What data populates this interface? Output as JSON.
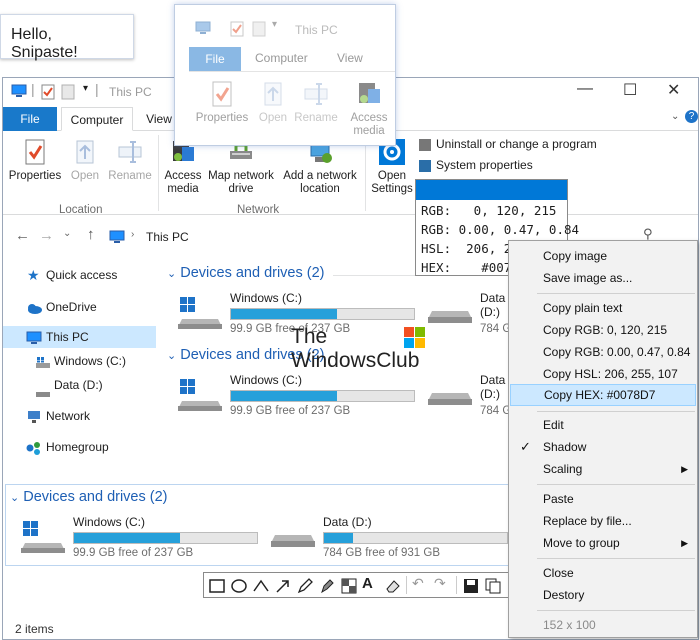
{
  "hello_text": "Hello, Snipaste!",
  "window": {
    "title": "This PC",
    "tabs": [
      "File",
      "Computer",
      "View"
    ],
    "ribbon": {
      "location_buttons": [
        "Properties",
        "Open",
        "Rename"
      ],
      "location_label": "Location",
      "network_buttons": [
        "Access media",
        "Map network drive",
        "Add a network location"
      ],
      "network_label": "Network",
      "system_button": "Open Settings",
      "system_items": [
        "Uninstall or change a program",
        "System properties"
      ]
    },
    "address": "This PC"
  },
  "nav": {
    "items": [
      "Quick access",
      "OneDrive",
      "This PC",
      "Windows (C:)",
      "Data (D:)",
      "Network",
      "Homegroup"
    ]
  },
  "sections": [
    {
      "title": "Devices and drives (2)"
    },
    {
      "title": "Devices and drives (2)"
    },
    {
      "title": "Devices and drives (2)"
    }
  ],
  "drives": {
    "c_name": "Windows (C:)",
    "c_free": "99.9 GB free of 237 GB",
    "c_used": 0.58,
    "d_name": "Data (D:)",
    "d_free": "784 GB free of 931 GB",
    "d_used": 0.16,
    "d_free_short": "784 G"
  },
  "snip": {
    "title": "This PC",
    "tabs": [
      "File",
      "Computer",
      "View"
    ],
    "buttons": [
      "Properties",
      "Open",
      "Rename",
      "Access media"
    ]
  },
  "color_panel": {
    "swatch_color": "#0078D7",
    "rgb": "RGB:   0, 120, 215",
    "rgbf": "RGB: 0.00, 0.47, 0.84",
    "hsl": "HSL:  206, 2",
    "hex": "HEX:    #007"
  },
  "menu": {
    "copy_image": "Copy image",
    "save_image": "Save image as...",
    "copy_plain": "Copy plain text",
    "copy_rgb": "Copy RGB: 0, 120, 215",
    "copy_rgbf": "Copy RGB: 0.00, 0.47, 0.84",
    "copy_hsl": "Copy HSL: 206, 255, 107",
    "copy_hex": "Copy HEX: #0078D7",
    "edit": "Edit",
    "shadow": "Shadow",
    "scaling": "Scaling",
    "paste": "Paste",
    "replace": "Replace by file...",
    "move_group": "Move to group",
    "close": "Close",
    "destroy": "Destory",
    "size": "152 x 100"
  },
  "watermark": [
    "The",
    "WindowsClub"
  ],
  "status": "2 items",
  "colors": {
    "accent": "#0078D7",
    "file_tab": "#1979CA",
    "drive_fill": "#26A0DA",
    "section_title": "#1E5FB4"
  }
}
